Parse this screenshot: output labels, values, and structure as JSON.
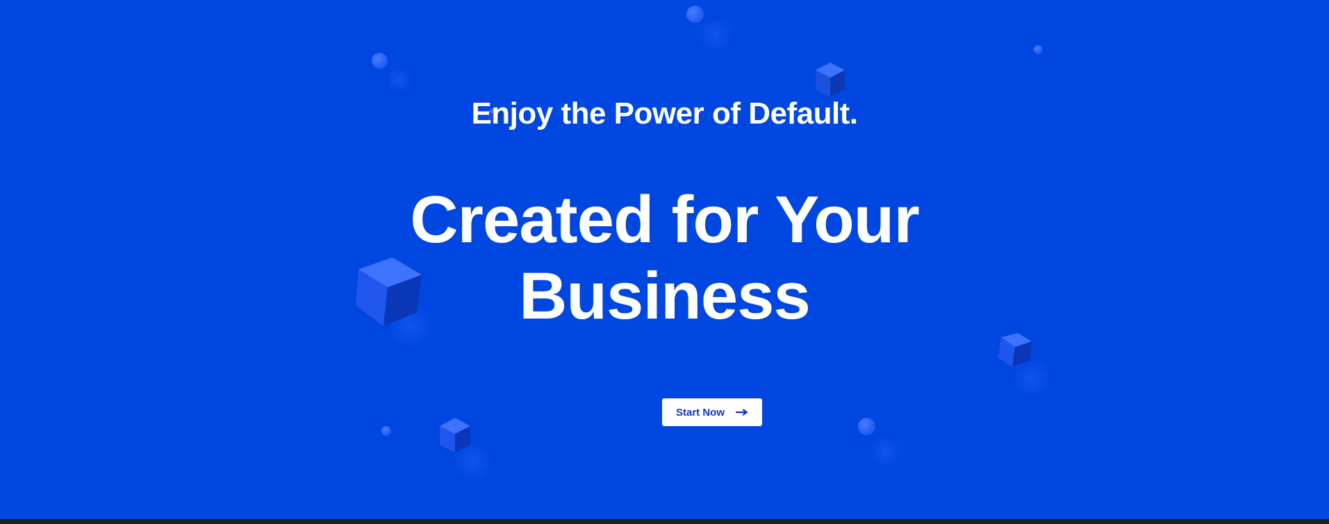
{
  "hero": {
    "subheading": "Enjoy the Power of Default.",
    "headline_line1": "Created for Your",
    "headline_line2": "Business",
    "cta_label": "Start Now",
    "cta_icon": "arrow-right-icon"
  },
  "colors": {
    "background": "#0047e1",
    "button_bg": "#ffffff",
    "button_text": "#0a36b8",
    "shape_light": "#3b6eff",
    "shape_dark": "#0a3cc4",
    "footer_bar": "#1e1f22"
  },
  "decorations": {
    "cubes": [
      "cube-icon",
      "cube-icon",
      "cube-icon",
      "cube-icon",
      "cube-icon"
    ],
    "spheres": [
      "sphere-icon",
      "sphere-icon",
      "sphere-icon",
      "sphere-icon",
      "sphere-icon"
    ]
  }
}
